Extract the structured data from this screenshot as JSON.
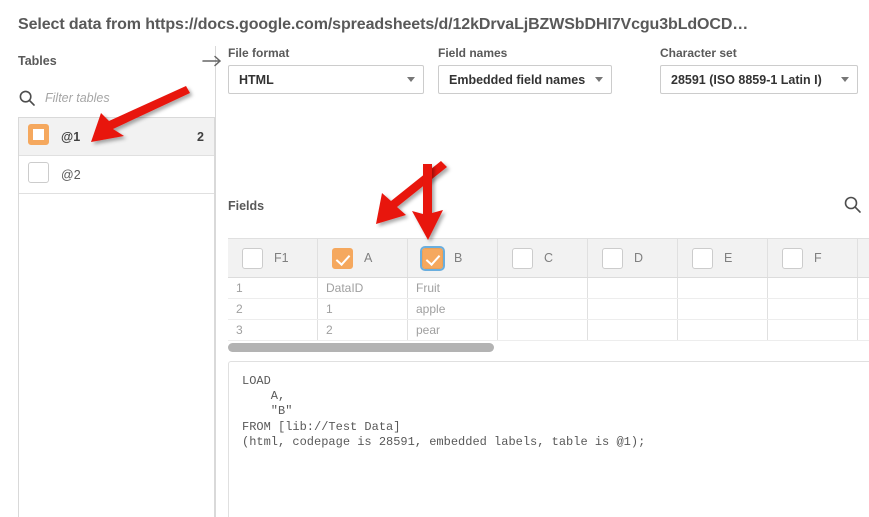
{
  "header": {
    "title": "Select data from https://docs.google.com/spreadsheets/d/12kDrvaLjBZWSbDHI7Vcgu3bLdOCD…"
  },
  "sidebar": {
    "heading": "Tables",
    "filter_placeholder": "Filter tables",
    "filter_value": "",
    "search_icon": "search-icon",
    "collapse_icon": "arrow-right-icon",
    "items": [
      {
        "label": "@1",
        "count": "2",
        "checkbox_state": "partial",
        "selected": true
      },
      {
        "label": "@2",
        "count": "",
        "checkbox_state": "unchecked",
        "selected": false
      }
    ]
  },
  "settings": {
    "file_format": {
      "label": "File format",
      "value": "HTML"
    },
    "field_names": {
      "label": "Field names",
      "value": "Embedded field names"
    },
    "character_set": {
      "label": "Character set",
      "value": "28591 (ISO 8859-1 Latin I)"
    }
  },
  "fields": {
    "heading": "Fields",
    "search_icon": "search-icon",
    "columns": [
      {
        "name": "F1",
        "checkbox_state": "unchecked",
        "focused": false
      },
      {
        "name": "A",
        "checkbox_state": "checked",
        "focused": false
      },
      {
        "name": "B",
        "checkbox_state": "checked",
        "focused": true
      },
      {
        "name": "C",
        "checkbox_state": "unchecked",
        "focused": false
      },
      {
        "name": "D",
        "checkbox_state": "unchecked",
        "focused": false
      },
      {
        "name": "E",
        "checkbox_state": "unchecked",
        "focused": false
      },
      {
        "name": "F",
        "checkbox_state": "unchecked",
        "focused": false
      }
    ],
    "rows": [
      {
        "num": "1",
        "cells": [
          "DataID",
          "Fruit",
          "",
          "",
          "",
          ""
        ]
      },
      {
        "num": "2",
        "cells": [
          "1",
          "apple",
          "",
          "",
          "",
          ""
        ]
      },
      {
        "num": "3",
        "cells": [
          "2",
          "pear",
          "",
          "",
          "",
          ""
        ]
      }
    ]
  },
  "script": {
    "text": "LOAD\n    A,\n    \"B\"\nFROM [lib://Test Data]\n(html, codepage is 28591, embedded labels, table is @1);"
  },
  "colors": {
    "accent_orange": "#f5a85e",
    "focus_blue": "#6aaede",
    "annotation_red": "#e8140d",
    "text_gray": "#595959"
  },
  "annotations": {
    "arrows": [
      {
        "name": "arrow-to-table-at1"
      },
      {
        "name": "arrow-to-field-a"
      },
      {
        "name": "arrow-to-field-b"
      }
    ]
  }
}
